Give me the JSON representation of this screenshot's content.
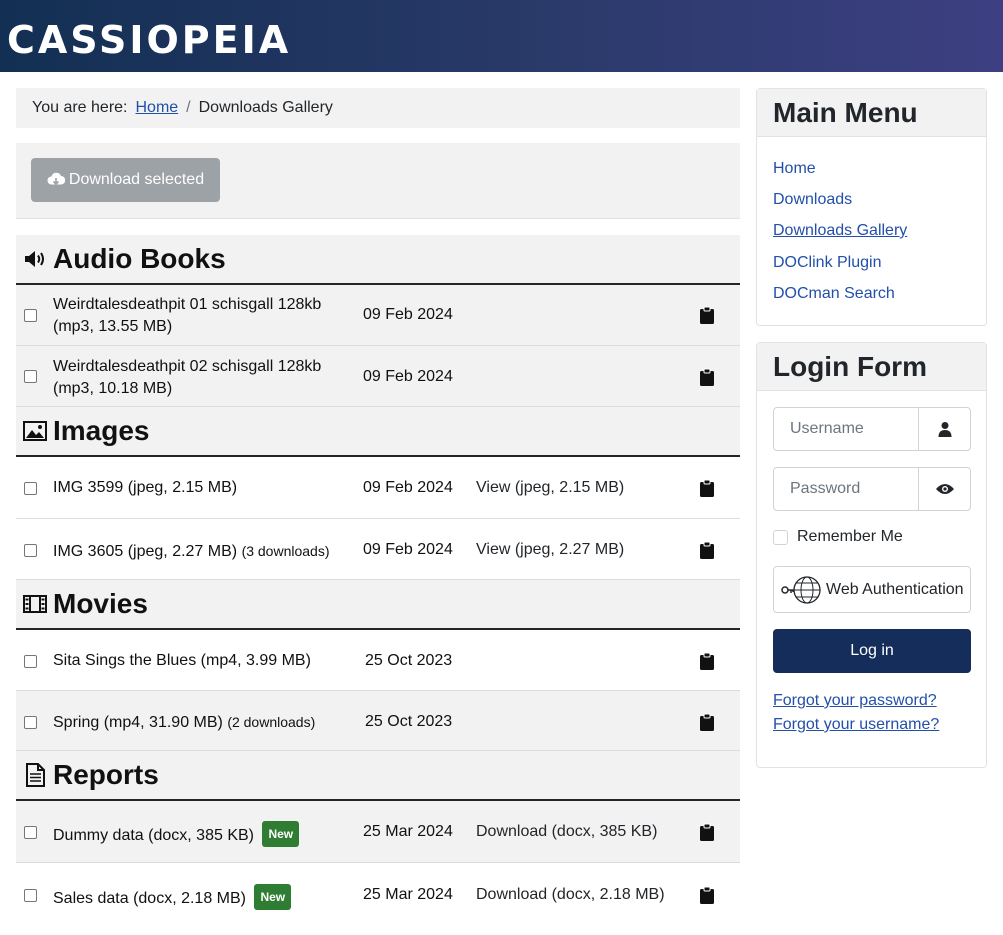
{
  "site": {
    "brand": "CASSIOPEIA"
  },
  "breadcrumb": {
    "prefix": "You are here:",
    "home": "Home",
    "separator": "/",
    "current": "Downloads Gallery"
  },
  "toolbar": {
    "download_selected": "Download selected",
    "icon": "cloud-download-icon"
  },
  "categories": {
    "audio": {
      "title": "Audio Books",
      "icon": "speaker-icon",
      "items": [
        {
          "name": "Weirdtalesdeathpit 01 schisgall 128kb",
          "meta": "(mp3, 13.55 MB)",
          "date": "09 Feb 2024"
        },
        {
          "name": "Weirdtalesdeathpit 02 schisgall 128kb",
          "meta": "(mp3, 10.18 MB)",
          "date": "09 Feb 2024"
        }
      ]
    },
    "images": {
      "title": "Images",
      "icon": "image-icon",
      "items": [
        {
          "name": "IMG 3599",
          "meta": "(jpeg, 2.15 MB)",
          "date": "09 Feb 2024",
          "action": "View (jpeg, 2.15 MB)"
        },
        {
          "name": "IMG 3605",
          "meta": "(jpeg, 2.27 MB)",
          "downloads": "(3 downloads)",
          "date": "09 Feb 2024",
          "action": "View (jpeg, 2.27 MB)"
        }
      ]
    },
    "movies": {
      "title": "Movies",
      "icon": "film-icon",
      "items": [
        {
          "name": "Sita Sings the Blues",
          "meta": "(mp4, 3.99 MB)",
          "date": "25 Oct 2023"
        },
        {
          "name": "Spring",
          "meta": "(mp4, 31.90 MB)",
          "downloads": "(2 downloads)",
          "date": "25 Oct 2023"
        }
      ]
    },
    "reports": {
      "title": "Reports",
      "icon": "document-icon",
      "items": [
        {
          "name": "Dummy data",
          "meta": "(docx, 385 KB)",
          "badge": "New",
          "date": "25 Mar 2024",
          "action": "Download (docx, 385 KB)"
        },
        {
          "name": "Sales data",
          "meta": "(docx, 2.18 MB)",
          "badge": "New",
          "date": "25 Mar 2024",
          "action": "Download (docx, 2.18 MB)"
        }
      ]
    }
  },
  "main_menu": {
    "title": "Main Menu",
    "items": [
      "Home",
      "Downloads",
      "Downloads Gallery",
      "DOClink Plugin",
      "DOCman Search"
    ],
    "current": "Downloads Gallery"
  },
  "login": {
    "title": "Login Form",
    "username_placeholder": "Username",
    "password_placeholder": "Password",
    "remember_me": "Remember Me",
    "web_auth": "Web Authentication",
    "login_button": "Log in",
    "forgot_password": "Forgot your password?",
    "forgot_username": "Forgot your username?"
  },
  "colors": {
    "header_start": "#132f53",
    "header_end": "#3d3f82",
    "link": "#224faa",
    "login_button": "#142d5a",
    "badge": "#2f7d32"
  }
}
